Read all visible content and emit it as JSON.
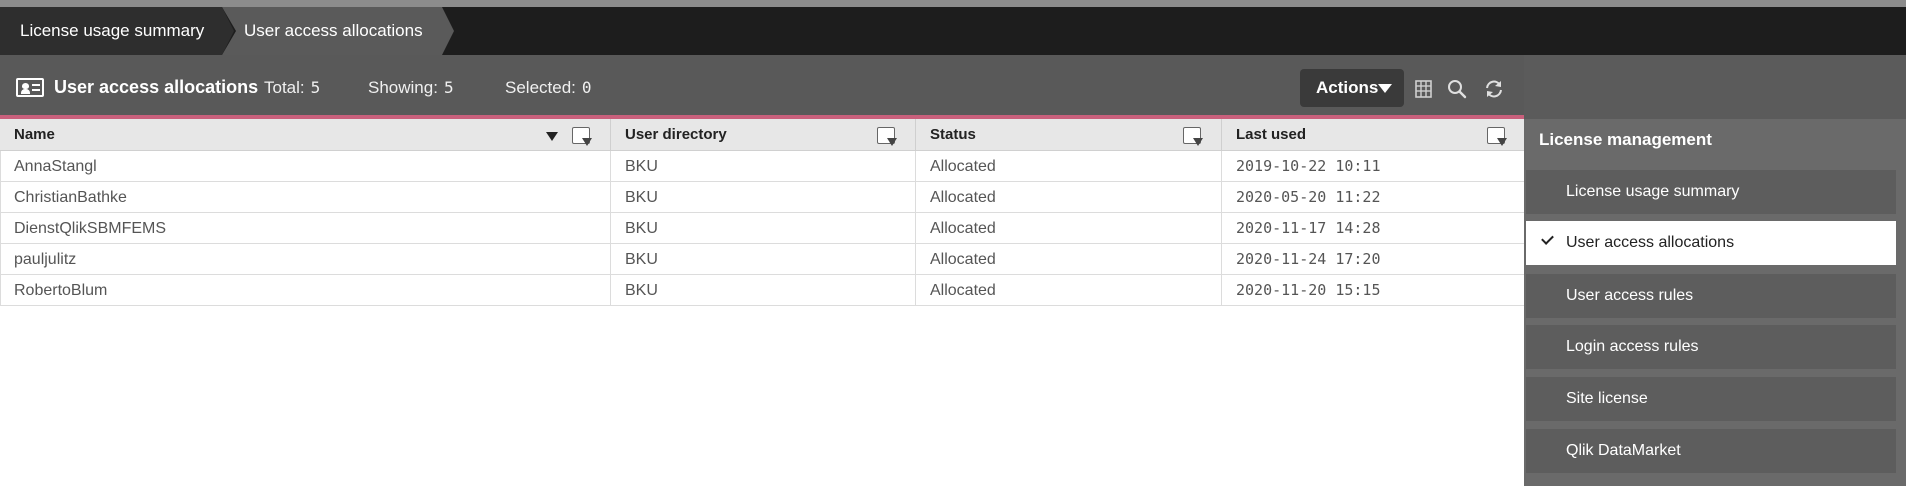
{
  "breadcrumbs": [
    "License usage summary",
    "User access allocations"
  ],
  "toolbar": {
    "title": "User access allocations",
    "total_label": "Total:",
    "total_value": "5",
    "showing_label": "Showing:",
    "showing_value": "5",
    "selected_label": "Selected:",
    "selected_value": "0",
    "actions_label": "Actions",
    "icons": [
      "columns-icon",
      "search-icon",
      "refresh-icon"
    ]
  },
  "table": {
    "columns": [
      "Name",
      "User directory",
      "Status",
      "Last used"
    ],
    "rows": [
      [
        "AnnaStangl",
        "BKU",
        "Allocated",
        "2019-10-22 10:11"
      ],
      [
        "ChristianBathke",
        "BKU",
        "Allocated",
        "2020-05-20 11:22"
      ],
      [
        "DienstQlikSBMFEMS",
        "BKU",
        "Allocated",
        "2020-11-17 14:28"
      ],
      [
        "pauljulitz",
        "BKU",
        "Allocated",
        "2020-11-24 17:20"
      ],
      [
        "RobertoBlum",
        "BKU",
        "Allocated",
        "2020-11-20 15:15"
      ]
    ]
  },
  "panel": {
    "title": "License management",
    "items": [
      {
        "label": "License usage summary",
        "active": false
      },
      {
        "label": "User access allocations",
        "active": true
      },
      {
        "label": "User access rules",
        "active": false
      },
      {
        "label": "Login access rules",
        "active": false
      },
      {
        "label": "Site license",
        "active": false
      },
      {
        "label": "Qlik DataMarket",
        "active": false
      }
    ]
  },
  "colors": {
    "accent": "#c9607c",
    "toolbar": "#595959",
    "header": "#1d1d1d"
  }
}
